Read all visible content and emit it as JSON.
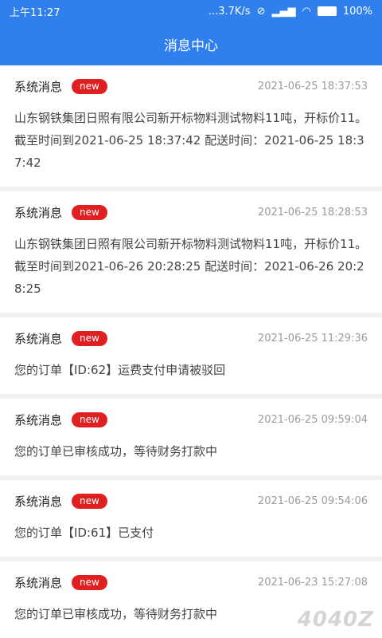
{
  "status_bar": {
    "time": "上午11:27",
    "speed": "...3.7K/s",
    "battery": "100%"
  },
  "header": {
    "title": "消息中心"
  },
  "messages": [
    {
      "title": "系统消息",
      "badge": "new",
      "time": "2021-06-25 18:37:53",
      "content": "山东钢铁集团日照有限公司新开标物料测试物料11吨，开标价11。截至时间到2021-06-25 18:37:42 配送时间：2021-06-25 18:37:42"
    },
    {
      "title": "系统消息",
      "badge": "new",
      "time": "2021-06-25 18:28:53",
      "content": "山东钢铁集团日照有限公司新开标物料测试物料11吨，开标价11。截至时间到2021-06-26 20:28:25 配送时间：2021-06-26 20:28:25"
    },
    {
      "title": "系统消息",
      "badge": "new",
      "time": "2021-06-25 11:29:36",
      "content": "您的订单【ID:62】运费支付申请被驳回"
    },
    {
      "title": "系统消息",
      "badge": "new",
      "time": "2021-06-25 09:59:04",
      "content": "您的订单已审核成功，等待财务打款中"
    },
    {
      "title": "系统消息",
      "badge": "new",
      "time": "2021-06-25 09:54:06",
      "content": "您的订单【ID:61】已支付"
    },
    {
      "title": "系统消息",
      "badge": "new",
      "time": "2021-06-23 15:27:08",
      "content": "您的订单已审核成功，等待财务打款中"
    }
  ],
  "watermark": "4040Z"
}
